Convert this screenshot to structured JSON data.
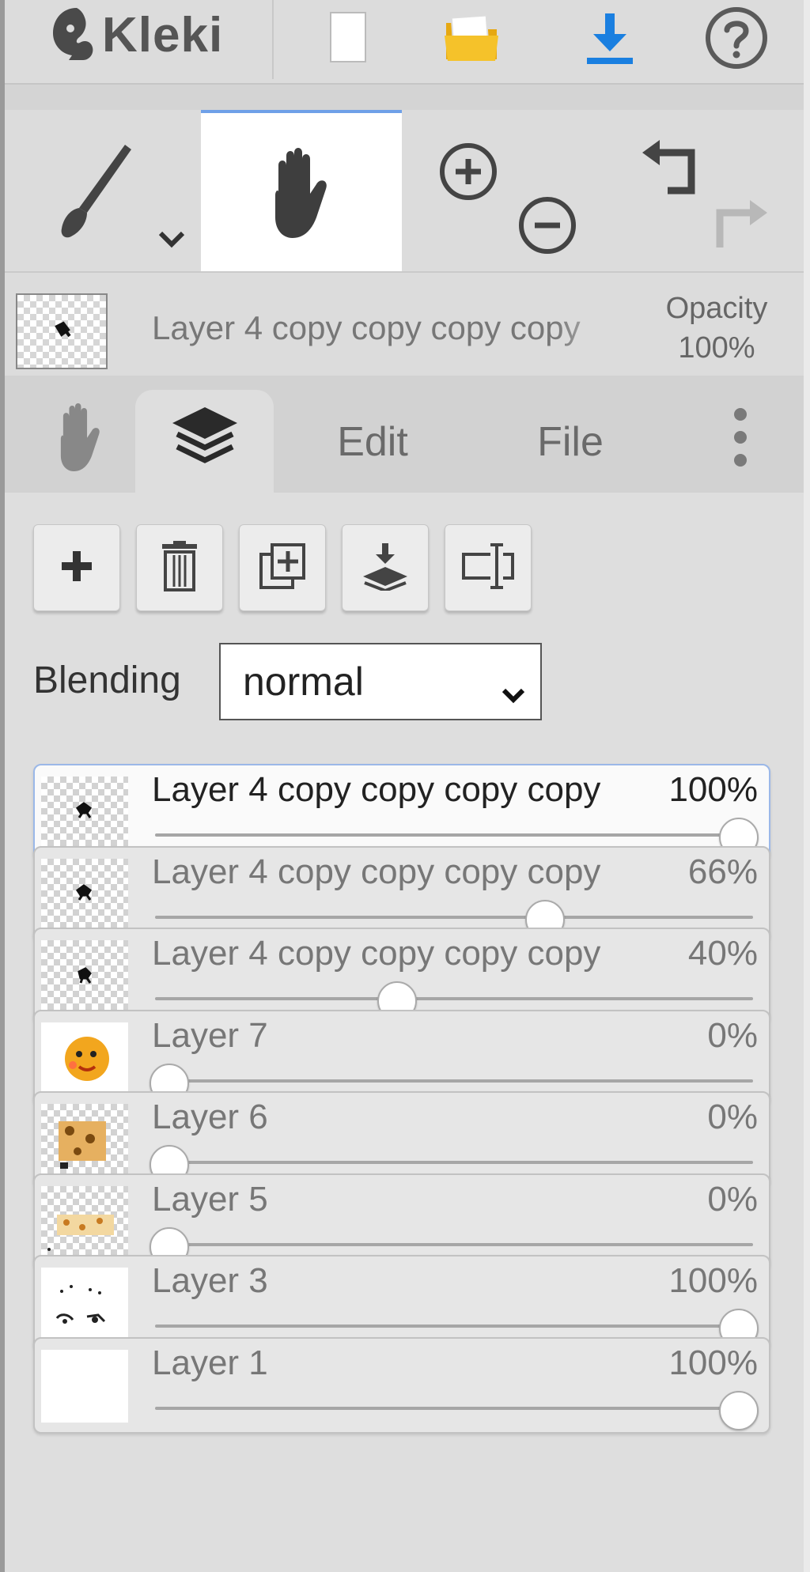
{
  "app": {
    "title": "Kleki",
    "header_icons": [
      "squirrel-logo-icon",
      "new-document-icon",
      "open-folder-icon",
      "download-icon",
      "help-icon"
    ]
  },
  "tools": {
    "brush": "brush-icon",
    "hand": "hand-icon",
    "zoom_in": "zoom-in-icon",
    "zoom_out": "zoom-out-icon",
    "undo": "undo-icon",
    "redo": "redo-icon"
  },
  "current_layer": {
    "name": "Layer 4 copy copy copy copy",
    "opacity_label": "Opacity",
    "opacity_value": "100%"
  },
  "tabs": {
    "hand_tab": "hand-icon",
    "layers_tab": "layers-icon",
    "edit": "Edit",
    "file": "File",
    "more": "more-icon"
  },
  "layer_buttons": [
    "add-layer-icon",
    "delete-layer-icon",
    "duplicate-layer-icon",
    "merge-down-icon",
    "rename-layer-icon"
  ],
  "blending": {
    "label": "Blending",
    "value": "normal"
  },
  "layers": [
    {
      "name": "Layer 4 copy copy copy copy",
      "opacity": "100%",
      "level": 1.0,
      "selected": true
    },
    {
      "name": "Layer 4 copy copy copy copy",
      "opacity": "66%",
      "level": 0.66
    },
    {
      "name": "Layer 4 copy copy copy copy",
      "opacity": "40%",
      "level": 0.4
    },
    {
      "name": "Layer 7",
      "opacity": "0%",
      "level": 0.0
    },
    {
      "name": "Layer 6",
      "opacity": "0%",
      "level": 0.0
    },
    {
      "name": "Layer 5",
      "opacity": "0%",
      "level": 0.0
    },
    {
      "name": "Layer 3",
      "opacity": "100%",
      "level": 1.0
    },
    {
      "name": "Layer 1",
      "opacity": "100%",
      "level": 1.0
    }
  ],
  "colors": {
    "accent": "#6fa0e8",
    "download": "#1a7fe0",
    "folder": "#f2b820"
  }
}
